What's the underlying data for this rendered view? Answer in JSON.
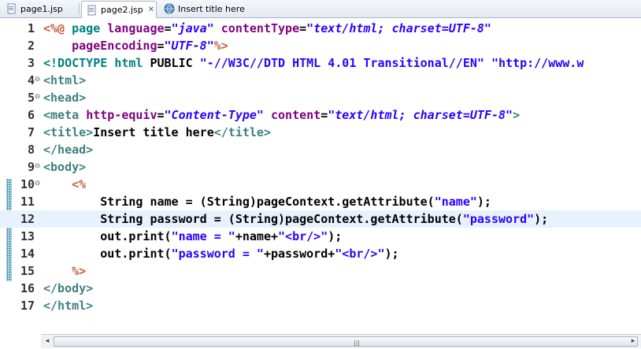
{
  "tabs": [
    {
      "label": "page1.jsp",
      "icon": "jsp-file-icon"
    },
    {
      "label": "page2.jsp",
      "icon": "jsp-file-icon",
      "active": true,
      "close": "✕"
    },
    {
      "label": "Insert title here",
      "icon": "globe-icon"
    }
  ],
  "colors": {
    "tag": "#3f7f7f",
    "attr": "#7f007f",
    "value": "#2a00ff",
    "jsp_delim": "#bf5f3f",
    "doctype": "#008080",
    "current_line": "#e8f2fe"
  },
  "lines": [
    {
      "num": "1",
      "tokens": [
        [
          "jsp",
          "<%@ "
        ],
        [
          "dt",
          "page "
        ],
        [
          "attr",
          "language"
        ],
        [
          "plain",
          "="
        ],
        [
          "val",
          "\"java\""
        ],
        [
          "plain",
          " "
        ],
        [
          "attr",
          "contentType"
        ],
        [
          "plain",
          "="
        ],
        [
          "val",
          "\"text/html; charset=UTF-8\""
        ]
      ]
    },
    {
      "num": "2",
      "tokens": [
        [
          "plain",
          "    "
        ],
        [
          "attr",
          "pageEncoding"
        ],
        [
          "plain",
          "="
        ],
        [
          "val",
          "\"UTF-8\""
        ],
        [
          "jsp",
          "%>"
        ]
      ]
    },
    {
      "num": "3",
      "tokens": [
        [
          "dt",
          "<!DOCTYPE "
        ],
        [
          "dt",
          "html "
        ],
        [
          "plain",
          "PUBLIC "
        ],
        [
          "str",
          "\"-//W3C//DTD HTML 4.01 Transitional//EN\" \"http://www.w"
        ]
      ]
    },
    {
      "num": "4",
      "fold": "⊖",
      "tokens": [
        [
          "tag",
          "<html>"
        ]
      ]
    },
    {
      "num": "5",
      "fold": "⊖",
      "tokens": [
        [
          "tag",
          "<head>"
        ]
      ]
    },
    {
      "num": "6",
      "tokens": [
        [
          "tag",
          "<meta "
        ],
        [
          "attr",
          "http-equiv"
        ],
        [
          "plain",
          "="
        ],
        [
          "val",
          "\"Content-Type\""
        ],
        [
          "plain",
          " "
        ],
        [
          "attr",
          "content"
        ],
        [
          "plain",
          "="
        ],
        [
          "val",
          "\"text/html; charset=UTF-8\""
        ],
        [
          "tag",
          ">"
        ]
      ]
    },
    {
      "num": "7",
      "tokens": [
        [
          "tag",
          "<title>"
        ],
        [
          "plain",
          "Insert title here"
        ],
        [
          "tag",
          "</title>"
        ]
      ]
    },
    {
      "num": "8",
      "tokens": [
        [
          "tag",
          "</head>"
        ]
      ]
    },
    {
      "num": "9",
      "fold": "⊖",
      "tokens": [
        [
          "tag",
          "<body>"
        ]
      ]
    },
    {
      "num": "10",
      "fold": "⊖",
      "tokens": [
        [
          "plain",
          "    "
        ],
        [
          "jsp",
          "<%"
        ]
      ]
    },
    {
      "num": "11",
      "tokens": [
        [
          "plain",
          "        String name = (String)pageContext.getAttribute("
        ],
        [
          "str",
          "\"name\""
        ],
        [
          "plain",
          ");"
        ]
      ]
    },
    {
      "num": "12",
      "current": true,
      "tokens": [
        [
          "plain",
          "        String password = (String)pageContext.getAttribute("
        ],
        [
          "str",
          "\"password\""
        ],
        [
          "plain",
          ");"
        ]
      ]
    },
    {
      "num": "13",
      "tokens": [
        [
          "plain",
          "        out.print("
        ],
        [
          "str",
          "\"name = \""
        ],
        [
          "plain",
          "+name+"
        ],
        [
          "str",
          "\"<br/>\""
        ],
        [
          "plain",
          ");"
        ]
      ]
    },
    {
      "num": "14",
      "tokens": [
        [
          "plain",
          "        out.print("
        ],
        [
          "str",
          "\"password = \""
        ],
        [
          "plain",
          "+password+"
        ],
        [
          "str",
          "\"<br/>\""
        ],
        [
          "plain",
          ");"
        ]
      ]
    },
    {
      "num": "15",
      "tokens": [
        [
          "plain",
          "    "
        ],
        [
          "jsp",
          "%>"
        ]
      ]
    },
    {
      "num": "16",
      "tokens": [
        [
          "tag",
          "</body>"
        ]
      ]
    },
    {
      "num": "17",
      "tokens": [
        [
          "tag",
          "</html>"
        ]
      ]
    }
  ],
  "scrollbar": {
    "left_arrow": "◂",
    "right_arrow": "▸",
    "grip": "|||"
  }
}
